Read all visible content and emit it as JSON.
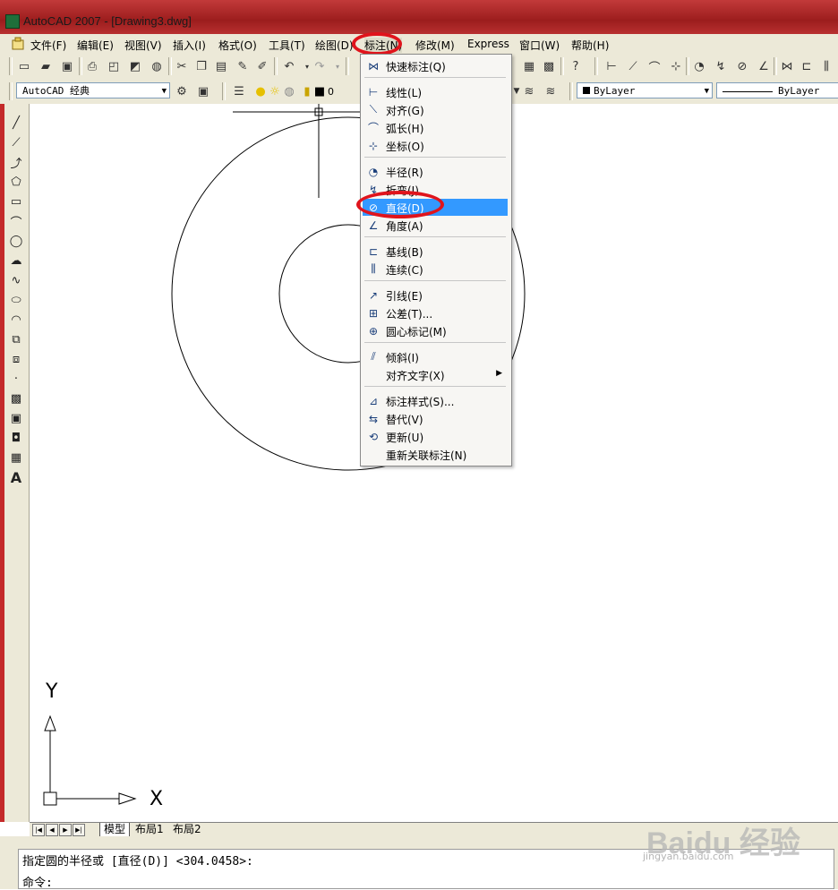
{
  "window": {
    "title": "AutoCAD 2007 - [Drawing3.dwg]"
  },
  "menubar": {
    "items": [
      {
        "label": "文件(F)"
      },
      {
        "label": "编辑(E)"
      },
      {
        "label": "视图(V)"
      },
      {
        "label": "插入(I)"
      },
      {
        "label": "格式(O)"
      },
      {
        "label": "工具(T)"
      },
      {
        "label": "绘图(D)"
      },
      {
        "label": "标注(N)"
      },
      {
        "label": "修改(M)"
      },
      {
        "label": "Express"
      },
      {
        "label": "窗口(W)"
      },
      {
        "label": "帮助(H)"
      }
    ]
  },
  "toolbar2": {
    "workspace": "AutoCAD 经典",
    "layer_value": "0",
    "color": "ByLayer",
    "linetype": "ByLayer"
  },
  "dimension_menu": {
    "items": [
      {
        "label": "快速标注(Q)",
        "icon": "quick-dimension-icon"
      },
      {
        "label": "线性(L)",
        "icon": "linear-dimension-icon"
      },
      {
        "label": "对齐(G)",
        "icon": "aligned-dimension-icon"
      },
      {
        "label": "弧长(H)",
        "icon": "arc-length-icon"
      },
      {
        "label": "坐标(O)",
        "icon": "ordinate-icon"
      },
      {
        "label": "半径(R)",
        "icon": "radius-icon"
      },
      {
        "label": "折弯(J)",
        "icon": "jogged-icon"
      },
      {
        "label": "直径(D)",
        "icon": "diameter-icon"
      },
      {
        "label": "角度(A)",
        "icon": "angular-icon"
      },
      {
        "label": "基线(B)",
        "icon": "baseline-icon"
      },
      {
        "label": "连续(C)",
        "icon": "continue-icon"
      },
      {
        "label": "引线(E)",
        "icon": "leader-icon"
      },
      {
        "label": "公差(T)...",
        "icon": "tolerance-icon"
      },
      {
        "label": "圆心标记(M)",
        "icon": "center-mark-icon"
      },
      {
        "label": "倾斜(I)",
        "icon": "oblique-icon"
      },
      {
        "label": "对齐文字(X)",
        "icon": "align-text-icon"
      },
      {
        "label": "标注样式(S)...",
        "icon": "dimension-style-icon"
      },
      {
        "label": "替代(V)",
        "icon": "override-icon"
      },
      {
        "label": "更新(U)",
        "icon": "update-icon"
      },
      {
        "label": "重新关联标注(N)",
        "icon": "reassociate-icon"
      }
    ],
    "highlighted": "直径(D)"
  },
  "ucs": {
    "x_label": "X",
    "y_label": "Y"
  },
  "tabs": [
    {
      "label": "模型"
    },
    {
      "label": "布局1"
    },
    {
      "label": "布局2"
    }
  ],
  "command": {
    "line1": "指定圆的半径或 [直径(D)] <304.0458>:",
    "line2": "命令:"
  },
  "watermark": {
    "text": "Baidu 经验",
    "sub": "jingyan.baidu.com"
  },
  "colors": {
    "highlight": "#3399ff",
    "annotation": "#e0141c",
    "titlebar": "#b02828"
  }
}
